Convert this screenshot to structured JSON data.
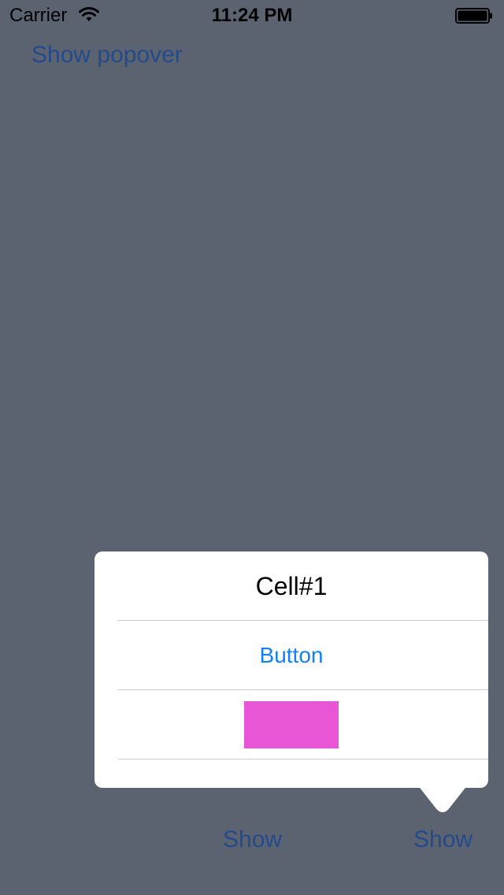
{
  "status_bar": {
    "carrier": "Carrier",
    "time": "11:24 PM",
    "wifi_icon": "wifi-icon",
    "battery_icon": "battery-icon"
  },
  "main": {
    "show_popover_label": "Show popover"
  },
  "popover": {
    "cell_title": "Cell#1",
    "button_label": "Button",
    "swatch_color": "#e855d5"
  },
  "bottom_bar": {
    "items": [
      {
        "label": "Show"
      },
      {
        "label": "Show"
      }
    ]
  },
  "colors": {
    "background": "#5c6370",
    "link": "#234a8b",
    "button_tint": "#147efb"
  }
}
